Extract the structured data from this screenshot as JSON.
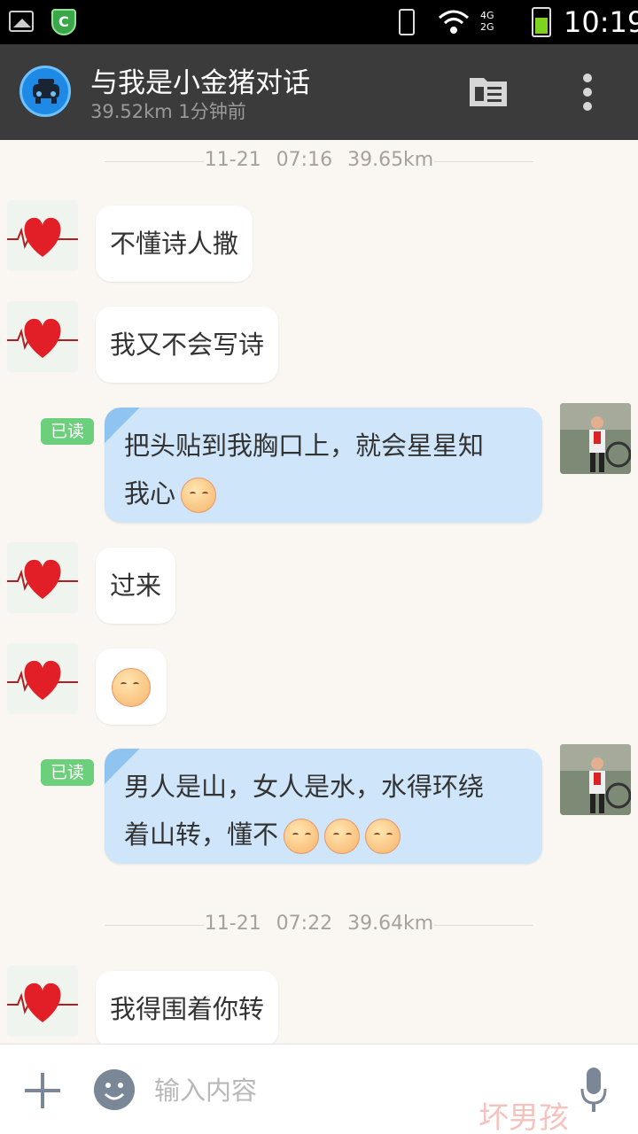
{
  "status_bar": {
    "time": "10:19",
    "network_top": "4G",
    "network_bottom": "2G"
  },
  "header": {
    "title": "与我是小金猪对话",
    "subtitle": "39.52km 1分钟前"
  },
  "chat": {
    "dividers": [
      {
        "text": "11-21 07:16   39.65km"
      },
      {
        "text": "11-21 07:22   39.64km"
      }
    ],
    "messages": [
      {
        "side": "in",
        "text": "不懂诗人撒"
      },
      {
        "side": "in",
        "text": "我又不会写诗"
      },
      {
        "side": "out",
        "line1": "把头贴到我胸口上，就会星星知",
        "line2": "我心",
        "read": "已读"
      },
      {
        "side": "in",
        "text": "过来"
      },
      {
        "side": "in",
        "emoji": "shy-emoji"
      },
      {
        "side": "out",
        "line1": "男人是山，女人是水，水得环绕",
        "line2": "着山转，懂不",
        "read": "已读"
      },
      {
        "side": "in",
        "text": "我得围着你转"
      }
    ]
  },
  "input_bar": {
    "placeholder": "输入内容"
  },
  "watermark": "坏男孩",
  "colors": {
    "header_bg": "#3b3b3b",
    "outgoing_bubble": "#cfe5f9",
    "read_badge": "#6ccf7b",
    "chat_bg": "#faf6f2"
  }
}
